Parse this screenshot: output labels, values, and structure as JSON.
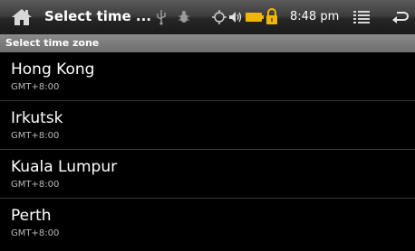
{
  "titlebar": {
    "title": "Select time ...",
    "time": "8:48 pm",
    "icons": [
      "home-icon",
      "usb-icon",
      "bug-icon",
      "gps-icon",
      "volume-icon",
      "battery-icon",
      "lock-icon",
      "menu-icon",
      "back-icon"
    ]
  },
  "section": {
    "label": "Select time zone"
  },
  "timezones": [
    {
      "name": "Hong Kong",
      "offset": "GMT+8:00"
    },
    {
      "name": "Irkutsk",
      "offset": "GMT+8:00"
    },
    {
      "name": "Kuala Lumpur",
      "offset": "GMT+8:00"
    },
    {
      "name": "Perth",
      "offset": "GMT+8:00"
    }
  ],
  "colors": {
    "background": "#000000",
    "battery": "#f2b705",
    "lock": "#f2b705"
  }
}
